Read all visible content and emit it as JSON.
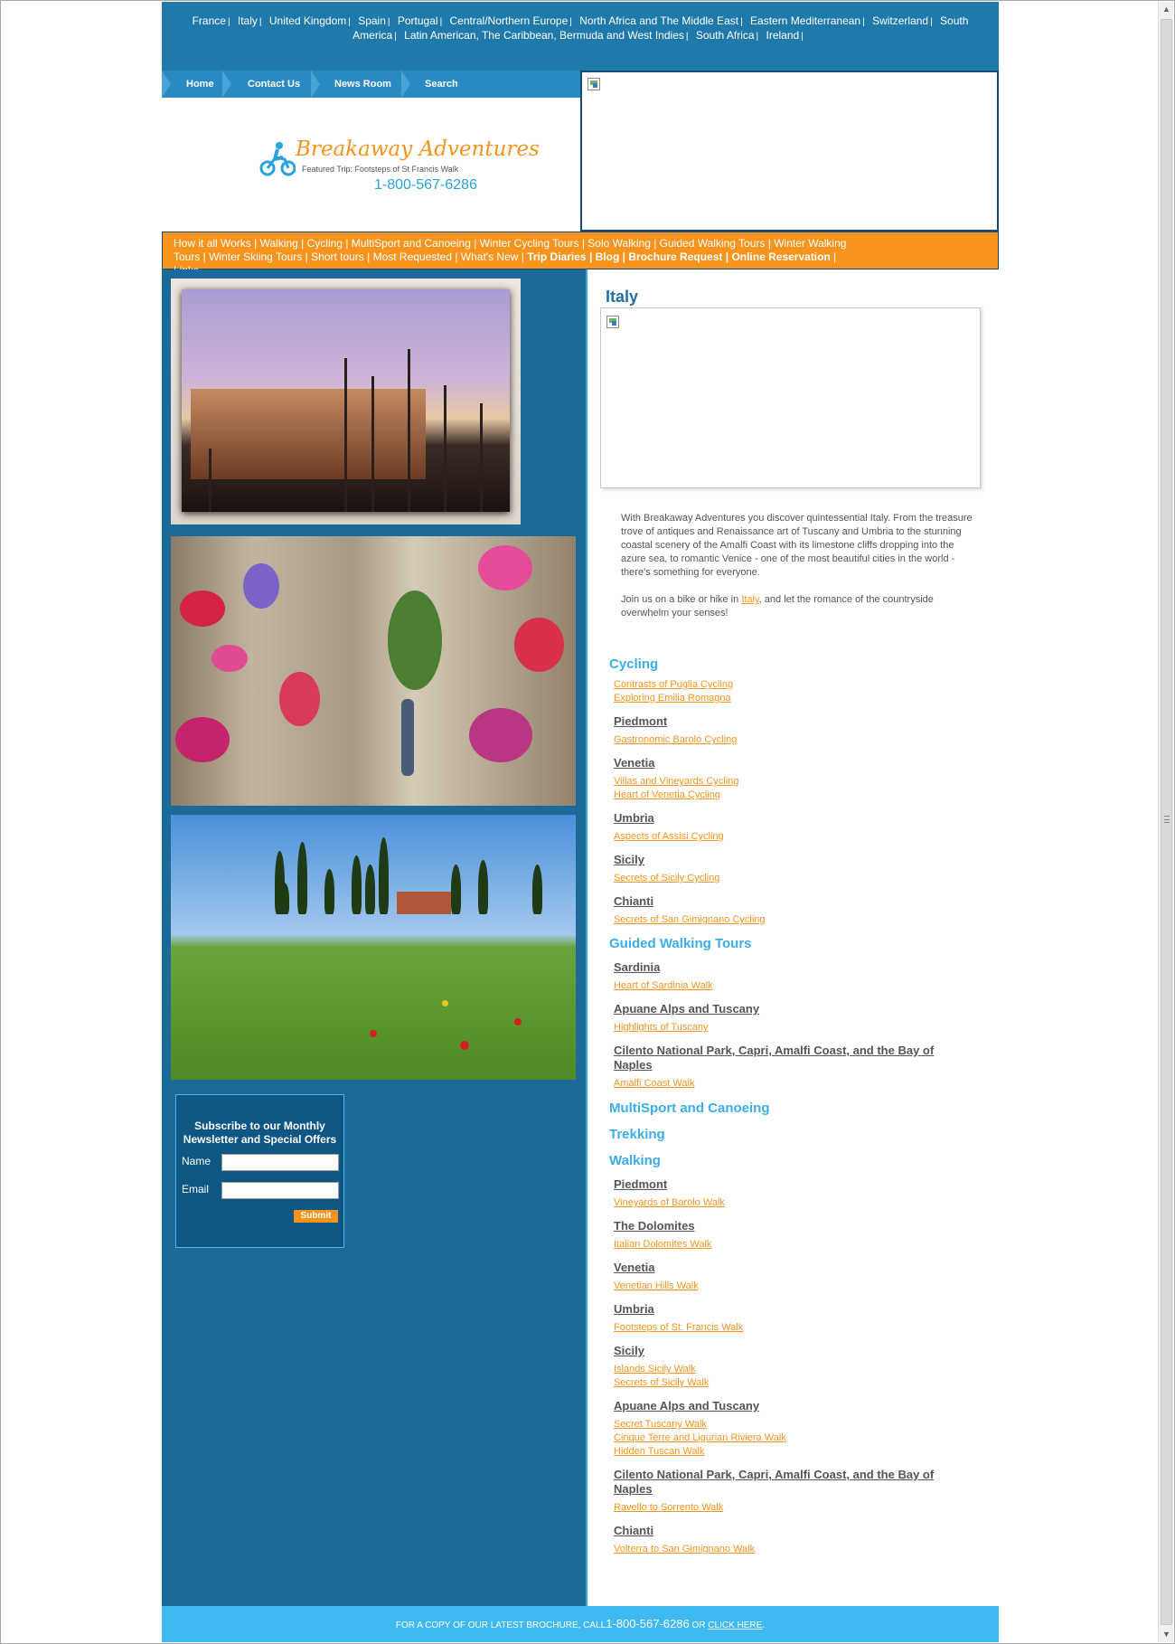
{
  "countries": [
    "France",
    "Italy",
    "United Kingdom",
    "Spain",
    "Portugal",
    "Central/Northern Europe",
    "North Africa and The Middle East",
    "Eastern Mediterranean",
    "Switzerland",
    "South America",
    "Latin American, The Caribbean, Bermuda and West Indies",
    "South Africa",
    "Ireland"
  ],
  "nav": {
    "home": "Home",
    "contact": "Contact Us",
    "news": "News Room",
    "search": "Search"
  },
  "logo": {
    "name": "Breakaway Adventures",
    "tagline": "Featured Trip: Footsteps of St Francis Walk",
    "phone": "1-800-567-6286"
  },
  "menu": {
    "how": "How it all Works",
    "walking": "Walking",
    "cycling": "Cycling",
    "multisport": "MultiSport and Canoeing",
    "winter_cycling": "Winter Cycling Tours",
    "solo": "Solo Walking",
    "guided": "Guided Walking Tours",
    "winter_walking": "Winter Walking Tours",
    "winter_skiing": "Winter Skiing Tours",
    "short": "Short tours",
    "most": "Most Requested",
    "whatsnew": "What's New",
    "diaries": "Trip Diaries",
    "blog": "Blog",
    "brochure": "Brochure Request",
    "reservation": "Online Reservation",
    "links": "Links"
  },
  "newsletter": {
    "title": "Subscribe to our Monthly Newsletter and Special Offers",
    "name_label": "Name",
    "email_label": "Email",
    "submit": "Submit"
  },
  "page": {
    "title": "Italy",
    "intro_p1": "With Breakaway Adventures you discover quintessential Italy. From the treasure trove of antiques and Renaissance art of Tuscany and Umbria to the stunning coastal scenery of the Amalfi Coast with its limestone cliffs dropping into the azure sea, to romantic Venice - one of the most beautiful cities in the world - there's something for everyone.",
    "intro_p2_before": "Join us on a bike or hike in ",
    "intro_p2_link": "Italy",
    "intro_p2_after": ", and let the romance of the countryside overwhelm your senses!"
  },
  "sections": {
    "cycling": "Cycling",
    "guided": "Guided Walking Tours",
    "multisport": "MultiSport and Canoeing",
    "trekking": "Trekking",
    "walking": "Walking"
  },
  "cycling": {
    "t1": "Contrasts of Puglia Cycling",
    "t2": "Exploring Emilia Romagna",
    "r_piedmont": "Piedmont",
    "piedmont1": "Gastronomic Barolo Cycling",
    "r_venetia": "Venetia",
    "venetia1": "Villas and Vineyards Cycling",
    "venetia2": "Heart of Venetia Cycling",
    "r_umbria": "Umbria",
    "umbria1": "Aspects of Assisi Cycling",
    "r_sicily": "Sicily",
    "sicily1": "Secrets of Sicily Cycling",
    "r_chianti": "Chianti",
    "chianti1": "Secrets of San Gimignano Cycling"
  },
  "guided": {
    "r_sardinia": "Sardinia",
    "sardinia1": "Heart of Sardinia Walk",
    "r_apuane": "Apuane Alps and Tuscany",
    "apuane1": "Highlights of Tuscany",
    "r_cilento": "Cilento National Park, Capri, Amalfi Coast, and the Bay of Naples",
    "cilento1": "Amalfi Coast Walk"
  },
  "walking": {
    "r_piedmont": "Piedmont",
    "piedmont1": "Vineyards of Barolo Walk",
    "r_dolomites": "The Dolomites",
    "dolomites1": "Italian Dolomites Walk",
    "r_venetia": "Venetia",
    "venetia1": "Venetian Hills Walk",
    "r_umbria": "Umbria",
    "umbria1": "Footsteps of St. Francis Walk",
    "r_sicily": "Sicily",
    "sicily1": "Islands Sicily Walk",
    "sicily2": "Secrets of Sicily Walk",
    "r_apuane": "Apuane Alps and Tuscany",
    "apuane1": "Secret Tuscany Walk",
    "apuane2": "Cinque Terre and Ligurian Riviera Walk",
    "apuane3": "Hidden Tuscan Walk",
    "r_cilento": "Cilento National Park, Capri, Amalfi Coast, and the Bay of Naples",
    "cilento1": "Ravello to Sorrento Walk",
    "r_chianti": "Chianti",
    "chianti1": "Volterra to San Gimignano Walk"
  },
  "footer": {
    "text": "FOR A COPY OF OUR LATEST BROCHURE, CALL",
    "phone": "1-800-567-6286",
    "or": "OR",
    "link": "CLICK HERE",
    "end": "."
  }
}
